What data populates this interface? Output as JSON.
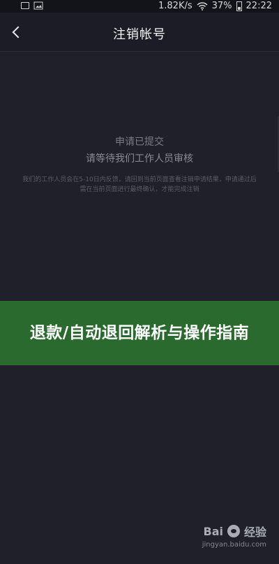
{
  "status_bar": {
    "network_speed": "1.82K/s",
    "battery_percent_text": "37%",
    "time": "22:22",
    "battery_level": 0.37
  },
  "header": {
    "title": "注销帐号"
  },
  "main": {
    "line1": "申请已提交",
    "line2": "请等待我们工作人员审核",
    "small_text_lines": [
      "我们的工作人员会在5-10日内反馈，请回到当前页面查看注销申请结果，申请通过后",
      "需在当前页面进行最终确认，才能完成注销"
    ]
  },
  "overlay": {
    "title": "退款/自动退回解析与操作指南"
  },
  "watermark": {
    "brand": "Bai",
    "brand_suffix": "经验",
    "url": "jingyan.baidu.com"
  },
  "icons": {
    "back": "back-chevron-icon",
    "wifi": "wifi-icon",
    "battery": "battery-icon",
    "image": "image-icon",
    "notification": "notification-square-icon",
    "baidu_paw": "baidu-paw-icon"
  },
  "colors": {
    "background": "#1b1c25",
    "overlay": "#2b6a2f",
    "text_primary": "#f2f2f2",
    "text_muted": "#8a8a93"
  }
}
